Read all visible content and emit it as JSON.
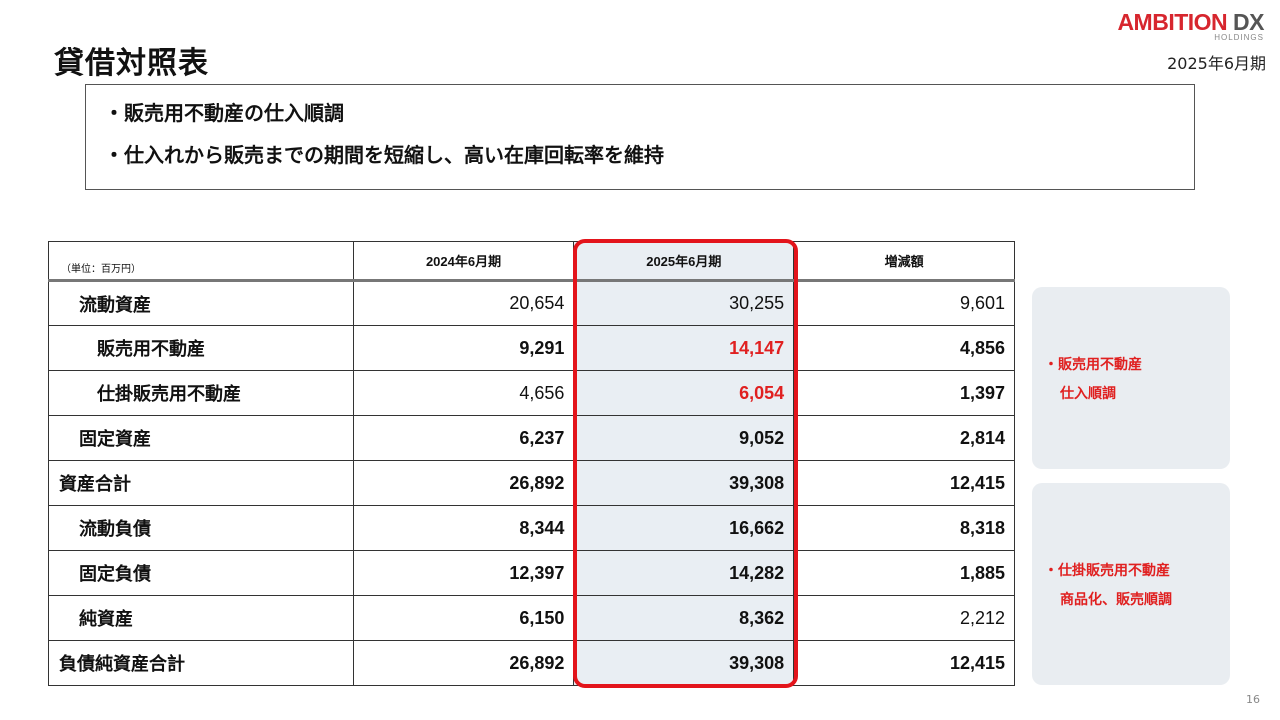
{
  "header": {
    "title": "貸借対照表",
    "period": "2025年6月期",
    "logo": {
      "main_red": "AMBITION",
      "main_gray": "DX",
      "sub": "HOLDINGS"
    }
  },
  "summary": {
    "lines": [
      "・販売用不動産の仕入順調",
      "・仕入れから販売までの期間を短縮し、高い在庫回転率を維持"
    ]
  },
  "table": {
    "unit": "（単位：百万円）",
    "columns": [
      "2024年6月期",
      "2025年6月期",
      "増減額"
    ],
    "rows": [
      {
        "label": "流動資産",
        "values": [
          "20,654",
          "30,255",
          "9,601"
        ]
      },
      {
        "label": "販売用不動産",
        "values": [
          "9,291",
          "14,147",
          "4,856"
        ]
      },
      {
        "label": "仕掛販売用不動産",
        "values": [
          "4,656",
          "6,054",
          "1,397"
        ]
      },
      {
        "label": "固定資産",
        "values": [
          "6,237",
          "9,052",
          "2,814"
        ]
      },
      {
        "label": "資産合計",
        "values": [
          "26,892",
          "39,308",
          "12,415"
        ]
      },
      {
        "label": "流動負債",
        "values": [
          "8,344",
          "16,662",
          "8,318"
        ]
      },
      {
        "label": "固定負債",
        "values": [
          "12,397",
          "14,282",
          "1,885"
        ]
      },
      {
        "label": "純資産",
        "values": [
          "6,150",
          "8,362",
          "2,212"
        ]
      },
      {
        "label": "負債純資産合計",
        "values": [
          "26,892",
          "39,308",
          "12,415"
        ]
      }
    ]
  },
  "notes": [
    {
      "line1": "・販売用不動産",
      "line2": "仕入順調"
    },
    {
      "line1": "・仕掛販売用不動産",
      "line2": "商品化、販売順調"
    }
  ],
  "page_number": "16",
  "colors": {
    "accent_red": "#e3141b",
    "highlight_bg": "#e9eef3",
    "panel_bg": "#e9edf1"
  }
}
